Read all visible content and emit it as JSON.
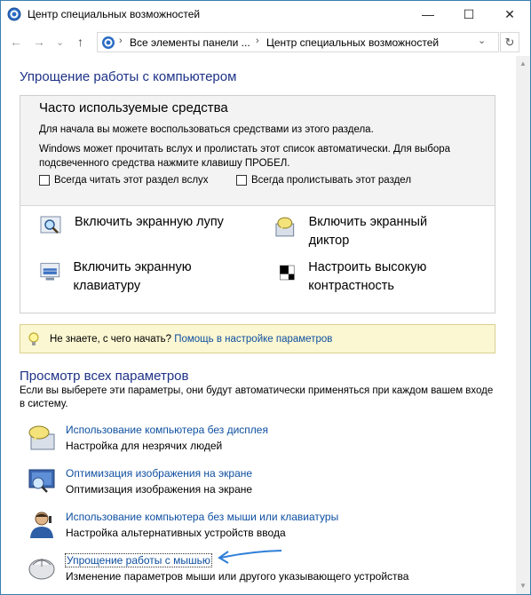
{
  "window": {
    "title": "Центр специальных возможностей",
    "minimize": "—",
    "maximize": "☐",
    "close": "✕"
  },
  "nav": {
    "back": "←",
    "forward": "→",
    "recent": "⌄",
    "up": "↑",
    "breadcrumbs": [
      "Все элементы панели ...",
      "Центр специальных возможностей"
    ],
    "breadcrumb_sep": "›",
    "dropdown": "⌄",
    "refresh": "↻"
  },
  "ease": {
    "heading": "Упрощение работы с компьютером",
    "quick_title": "Часто используемые средства",
    "line1": "Для начала вы можете воспользоваться средствами из этого раздела.",
    "line2": "Windows может прочитать вслух и пролистать этот список автоматически. Для выбора подсвеченного средства нажмите клавишу ПРОБЕЛ.",
    "checkbox_read": "Всегда читать этот раздел вслух",
    "checkbox_scan": "Всегда пролистывать этот раздел",
    "tools": [
      {
        "label": "Включить экранную лупу",
        "icon": "magnifier-icon"
      },
      {
        "label": "Включить экранный диктор",
        "icon": "narrator-icon"
      },
      {
        "label": "Включить экранную клавиатуру",
        "icon": "keyboard-icon"
      },
      {
        "label": "Настроить высокую контрастность",
        "icon": "contrast-icon"
      }
    ]
  },
  "tip": {
    "text": "Не знаете, с чего начать?",
    "link": "Помощь в настройке параметров"
  },
  "browse": {
    "heading": "Просмотр всех параметров",
    "description": "Если вы выберете эти параметры, они будут автоматически применяться при каждом вашем входе в систему.",
    "items": [
      {
        "link": "Использование компьютера без дисплея",
        "sub": "Настройка для незрячих людей",
        "icon": "speech-bubble-icon"
      },
      {
        "link": "Оптимизация изображения на экране",
        "sub": "Оптимизация изображения на экране",
        "icon": "monitor-icon"
      },
      {
        "link": "Использование компьютера без мыши или клавиатуры",
        "sub": "Настройка альтернативных устройств ввода",
        "icon": "person-icon"
      },
      {
        "link": "Упрощение работы с мышью",
        "sub": "Изменение параметров мыши или другого указывающего устройства",
        "icon": "mouse-icon"
      }
    ]
  },
  "colors": {
    "heading": "#1e3287",
    "link": "#0e4fa0",
    "tip_bg": "#fbf7d2",
    "arrow": "#2f7fd8"
  }
}
